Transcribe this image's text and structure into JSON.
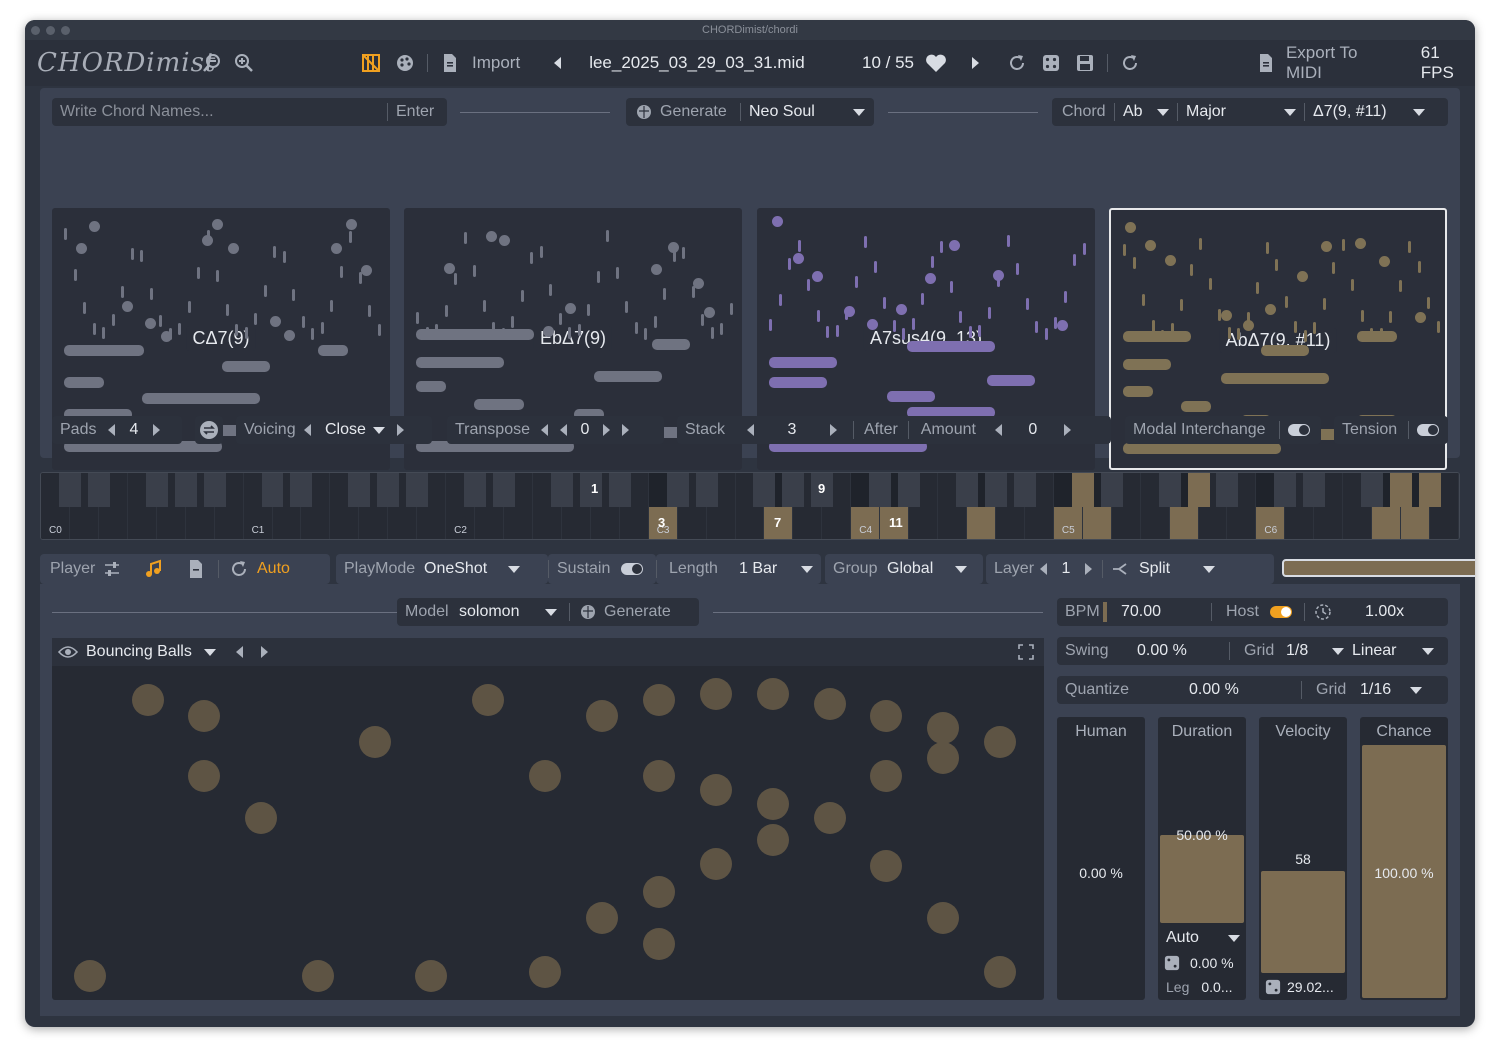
{
  "window": {
    "title": "CHORDimist/chordi"
  },
  "toolbar": {
    "logo": "CHORDimist",
    "import_label": "Import",
    "file_name": "lee_2025_03_29_03_31.mid",
    "counter": "10 / 55",
    "export_label": "Export To MIDI",
    "fps": "61 FPS"
  },
  "chordbar": {
    "write_placeholder": "Write Chord Names...",
    "enter_label": "Enter",
    "generate_label": "Generate",
    "style_value": "Neo Soul",
    "chord_label": "Chord",
    "root_value": "Ab",
    "quality_value": "Major",
    "extension_value": "Δ7(9, #11)"
  },
  "pads": [
    {
      "name": "CΔ7(9)",
      "color": "#6f7381"
    },
    {
      "name": "EbΔ7(9)",
      "color": "#6f7381"
    },
    {
      "name": "A7sus4(9, 13)",
      "color": "#7e6fb0"
    },
    {
      "name": "AbΔ7(9, #11)",
      "color": "#7f7255"
    }
  ],
  "padcontrols": {
    "pads_label": "Pads",
    "pads_value": "4",
    "voicing_label": "Voicing",
    "voicing_value": "Close",
    "transpose_label": "Transpose",
    "transpose_value": "0",
    "stack_label": "Stack",
    "stack_value": "3",
    "after_label": "After",
    "amount_label": "Amount",
    "amount_value": "0",
    "modal_label": "Modal Interchange",
    "tension_label": "Tension"
  },
  "keyboard": {
    "octaves": [
      "C0",
      "C1",
      "C2",
      "C3",
      "C4",
      "C5",
      "C6"
    ],
    "degree_labels": [
      "1",
      "3",
      "7",
      "9",
      "11"
    ]
  },
  "player": {
    "player_label": "Player",
    "auto_label": "Auto",
    "playmode_label": "PlayMode",
    "playmode_value": "OneShot",
    "sustain_label": "Sustain",
    "length_label": "Length",
    "length_value": "1 Bar",
    "group_label": "Group",
    "group_value": "Global",
    "layer_label": "Layer",
    "layer_value": "1",
    "split_label": "Split"
  },
  "model": {
    "model_label": "Model",
    "model_value": "solomon",
    "generate_label": "Generate"
  },
  "pattern": {
    "preset_name": "Bouncing Balls"
  },
  "tempo": {
    "bpm_label": "BPM",
    "bpm_value": "70.00",
    "host_label": "Host",
    "rate_value": "1.00x",
    "swing_label": "Swing",
    "swing_value": "0.00 %",
    "grid_label": "Grid",
    "grid_value": "1/8",
    "curve_value": "Linear",
    "quantize_label": "Quantize",
    "quantize_value": "0.00 %",
    "qgrid_label": "Grid",
    "qgrid_value": "1/16"
  },
  "sliders": {
    "human": {
      "label": "Human",
      "value": "0.00 %",
      "fraction": 0
    },
    "duration": {
      "label": "Duration",
      "value": "50.00 %",
      "fraction": 0.5,
      "mode": "Auto",
      "rand": "0.00 %",
      "leg_label": "Leg",
      "leg_value": "0.0..."
    },
    "velocity": {
      "label": "Velocity",
      "value": "58",
      "rand": "29.02..."
    },
    "chance": {
      "label": "Chance",
      "value": "100.00 %",
      "fraction": 1
    }
  },
  "colors": {
    "accent": "#f0a020",
    "gold": "#7c6c52",
    "ball": "#5e5444"
  }
}
